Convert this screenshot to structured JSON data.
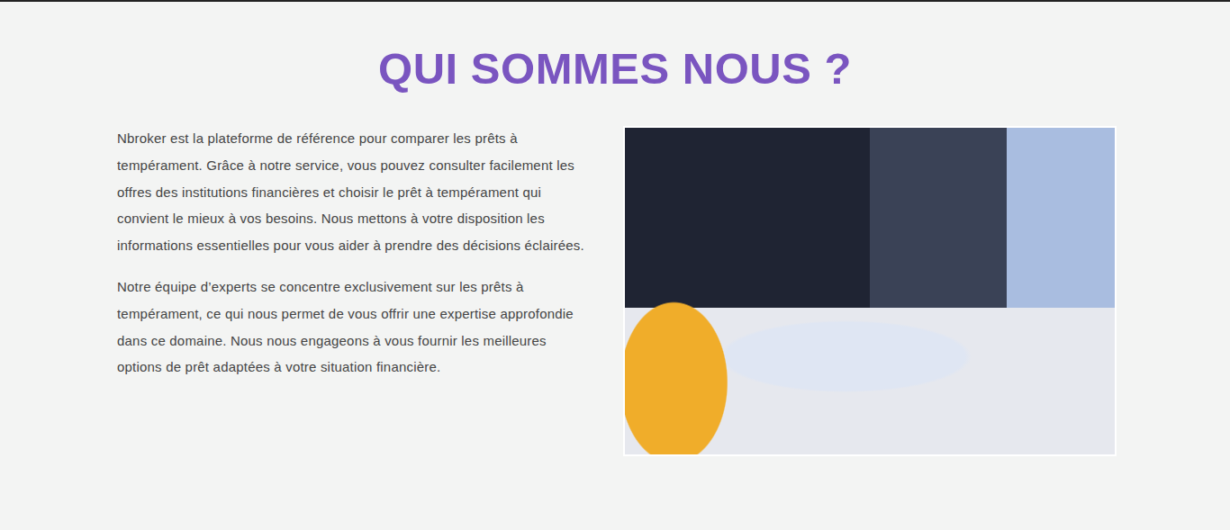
{
  "section": {
    "title": "QUI SOMMES NOUS ?",
    "paragraphs": [
      "Nbroker est la plateforme de référence pour comparer les prêts à tempérament. Grâce à notre service, vous pouvez consulter facilement les offres des institutions financières et choisir le prêt à tempérament qui convient le mieux à vos besoins. Nous mettons à votre disposition les informations essentielles pour vous aider à prendre des décisions éclairées.",
      "Notre équipe d’experts se concentre exclusivement sur les prêts à tempérament, ce qui nous permet de vous offrir une expertise approfondie dans ce domaine. Nous nous engageons à vous fournir les meilleures options de prêt adaptées à votre situation financière."
    ]
  }
}
